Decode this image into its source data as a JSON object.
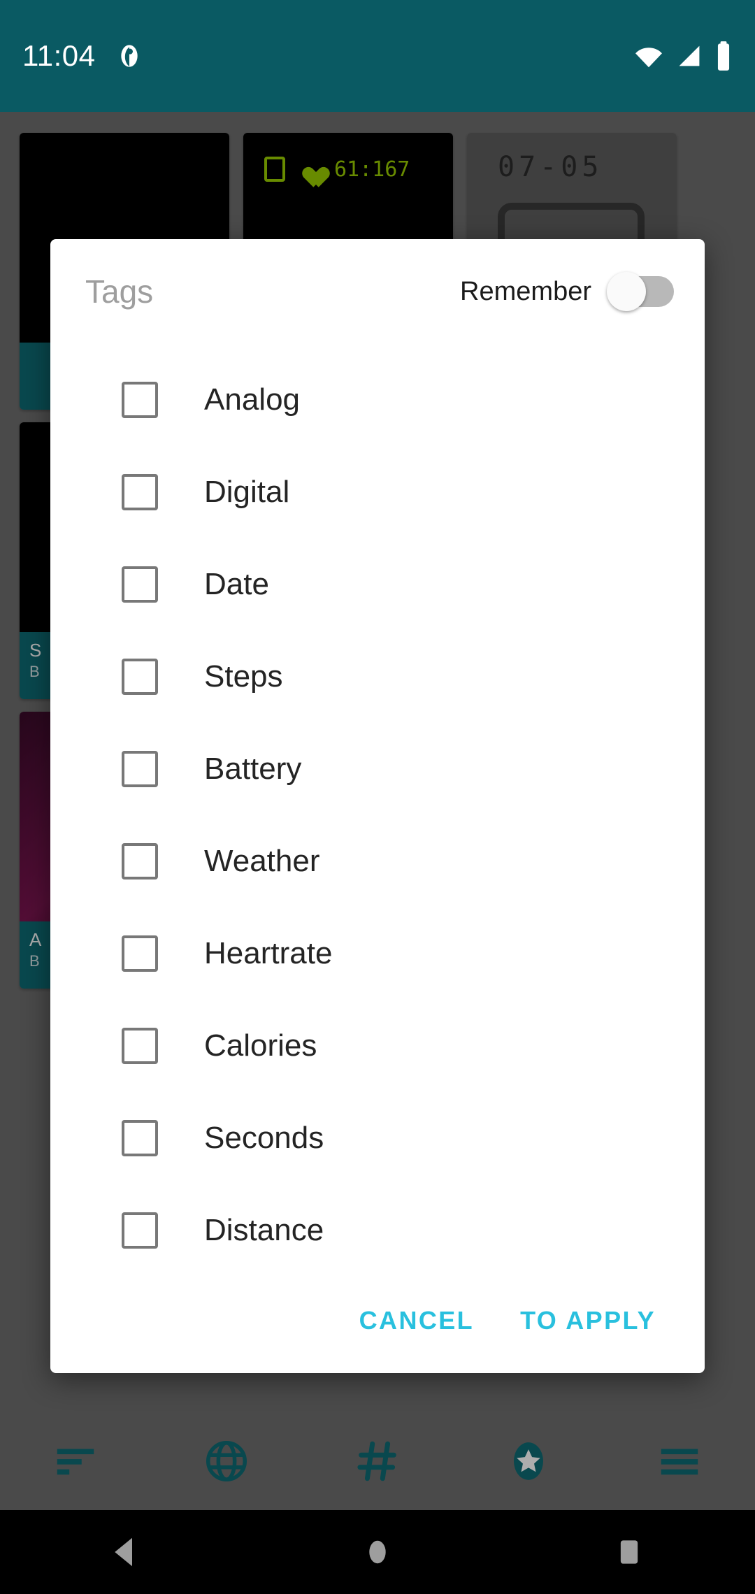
{
  "status_bar": {
    "time": "11:04",
    "background_color": "#0A5A63",
    "icons": [
      "notification-dot-icon",
      "wifi-icon",
      "cellular-signal-icon",
      "battery-icon"
    ]
  },
  "dialog": {
    "title": "Tags",
    "remember": {
      "label": "Remember",
      "enabled": false
    },
    "tags": [
      {
        "label": "Analog",
        "checked": false
      },
      {
        "label": "Digital",
        "checked": false
      },
      {
        "label": "Date",
        "checked": false
      },
      {
        "label": "Steps",
        "checked": false
      },
      {
        "label": "Battery",
        "checked": false
      },
      {
        "label": "Weather",
        "checked": false
      },
      {
        "label": "Heartrate",
        "checked": false
      },
      {
        "label": "Calories",
        "checked": false
      },
      {
        "label": "Seconds",
        "checked": false
      },
      {
        "label": "Distance",
        "checked": false
      }
    ],
    "actions": {
      "cancel_label": "CANCEL",
      "apply_label": "TO APPLY",
      "accent_color": "#29C0DE"
    }
  },
  "background": {
    "accent_color": "#0E6A73",
    "cards": [
      {
        "thumb_text": "",
        "footer_title": "",
        "footer_sub": ""
      },
      {
        "thumb_text": "61:167",
        "footer_title": "",
        "footer_sub": ""
      },
      {
        "thumb_text": "07-05",
        "footer_title": "",
        "footer_sub": ""
      },
      {
        "thumb_text": "",
        "footer_title": "S",
        "footer_sub": "B"
      },
      {
        "thumb_text": "",
        "footer_title": "",
        "footer_sub": ""
      },
      {
        "thumb_text": "",
        "footer_title": "",
        "footer_sub": ""
      },
      {
        "thumb_text": "",
        "footer_title": "A",
        "footer_sub": "B"
      },
      {
        "thumb_text": "",
        "footer_title": "",
        "footer_sub": ""
      },
      {
        "thumb_text": "",
        "footer_title": "",
        "footer_sub": ""
      }
    ]
  },
  "bottom_nav": {
    "color": "#0E6A73",
    "items": [
      {
        "icon": "sort-lines-icon"
      },
      {
        "icon": "globe-icon"
      },
      {
        "icon": "hashtag-icon"
      },
      {
        "icon": "star-circle-icon"
      },
      {
        "icon": "menu-hamburger-icon"
      }
    ]
  },
  "system_nav": {
    "items": [
      {
        "icon": "back-triangle-icon"
      },
      {
        "icon": "home-circle-icon"
      },
      {
        "icon": "recents-square-icon"
      }
    ]
  }
}
